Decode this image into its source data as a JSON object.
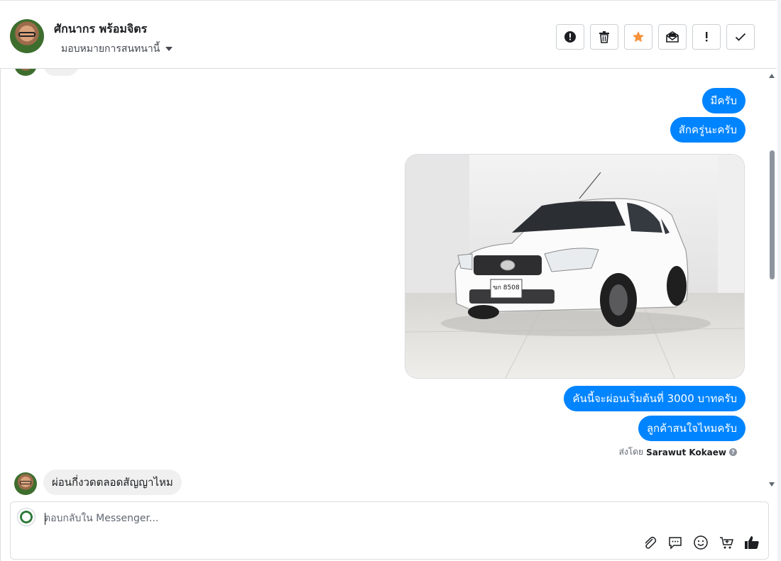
{
  "header": {
    "contact_name": "ศักนากร พร้อมจิตร",
    "assign_label": "มอบหมายการสนทนานี้",
    "toolbar": [
      {
        "name": "report-spam-button",
        "icon": "alert-circle-icon"
      },
      {
        "name": "delete-button",
        "icon": "trash-icon"
      },
      {
        "name": "star-button",
        "icon": "star-icon",
        "color": "#f7923b"
      },
      {
        "name": "mark-unread-button",
        "icon": "envelope-open-icon"
      },
      {
        "name": "follow-up-button",
        "icon": "exclamation-icon"
      },
      {
        "name": "mark-done-button",
        "icon": "checkmark-icon"
      }
    ]
  },
  "messages": {
    "out_1": "มีครับ",
    "out_2": "สักครู่นะครับ",
    "photo_alt": "รถยนต์สีขาว",
    "plate_text": "ขก 8508",
    "out_3": "คันนี้จะผ่อนเริ่มต้นที่ 3000 บาทครับ",
    "out_4": "ลูกค้าสนใจไหมครับ",
    "sent_by_label": "ส่งโดย",
    "sent_by_name": "Sarawut Kokaew",
    "in_1": "ผ่อนกี่งวดตลอดสัญญาไหม"
  },
  "composer": {
    "placeholder": "ตอบกลับใน Messenger...",
    "icons": [
      "paperclip-icon",
      "chat-bubble-icon",
      "emoji-icon",
      "cart-icon",
      "thumbs-up-icon"
    ]
  },
  "colors": {
    "outgoing_bubble": "#0084ff",
    "incoming_bubble": "#f0f0f0",
    "star": "#f7923b"
  }
}
